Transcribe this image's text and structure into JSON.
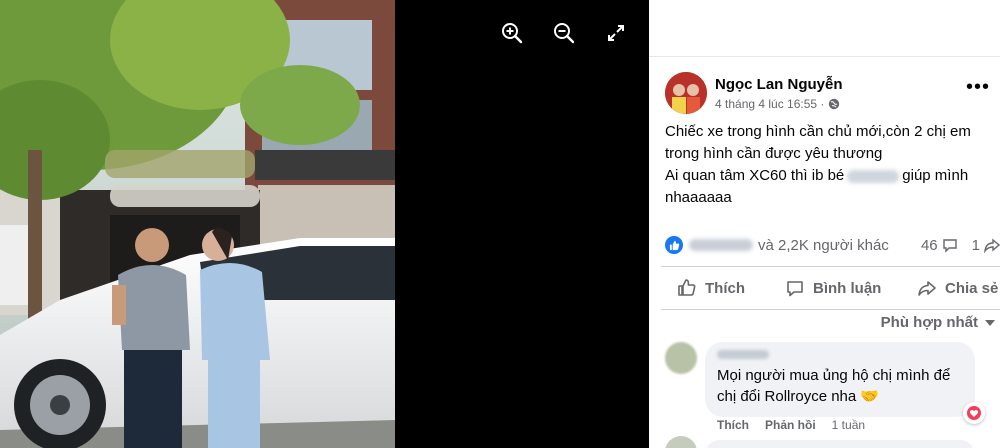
{
  "viewer": {
    "tools": [
      {
        "icon": "zoom-in-icon"
      },
      {
        "icon": "zoom-out-icon"
      },
      {
        "icon": "fullscreen-icon"
      }
    ]
  },
  "post": {
    "author": "Ngọc Lan Nguyễn",
    "timestamp": "4 tháng 4 lúc 16:55 ·",
    "privacy_icon": "globe-icon",
    "text_line1": "Chiếc xe trong hình cần chủ mới,còn 2 chị em trong hình cần được yêu thương",
    "text_line2_before": "Ai quan tâm XC60 thì ib bé",
    "text_line2_after": "giúp mình nhaaaaaa",
    "reactions_text": "và 2,2K người khác",
    "comment_count": "46",
    "share_count": "1"
  },
  "actions": {
    "like": "Thích",
    "comment": "Bình luận",
    "share": "Chia sẻ"
  },
  "sort_label": "Phù hợp nhất",
  "comment": {
    "text": "Mọi người mua ủng hộ chị mình để chị đổi Rollroyce nha 🤝",
    "like": "Thích",
    "reply": "Phản hồi",
    "age": "1 tuần"
  },
  "colors": {
    "accent": "#1877f2",
    "heart": "#f33e58"
  }
}
